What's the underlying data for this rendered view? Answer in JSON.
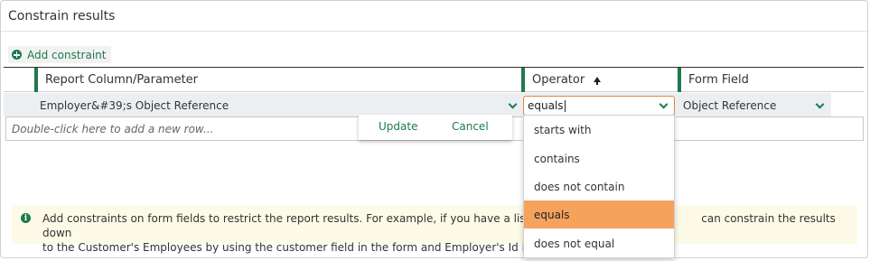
{
  "panel": {
    "title": "Constrain results"
  },
  "toolbar": {
    "add_constraint_label": "Add constraint",
    "add_icon": "plus-circle-icon"
  },
  "grid": {
    "columns": [
      {
        "label": "Report Column/Parameter"
      },
      {
        "label": "Operator",
        "sort": "ascending",
        "sort_icon": "arrow-up-icon"
      },
      {
        "label": "Form Field"
      }
    ],
    "edit_row": {
      "report_column": "Employer&#39;s Object Reference",
      "operator": "equals",
      "form_field": "Object Reference"
    },
    "new_row_placeholder": "Double-click here to add a new row..."
  },
  "row_actions": {
    "update_label": "Update",
    "cancel_label": "Cancel"
  },
  "operator_dropdown": {
    "options": [
      "starts with",
      "contains",
      "does not contain",
      "equals",
      "does not equal"
    ],
    "selected": "equals"
  },
  "info": {
    "icon": "info-icon",
    "line1_before": "Add constraints on form fields to restrict the report results. For example, if you have a list",
    "line1_after": "can constrain the results down",
    "line2": "to the Customer's Employees by using the customer field in the form and Employer's Id in"
  },
  "colors": {
    "accent": "#1c7a4e",
    "highlight": "#f5a25d",
    "focus_border": "#e8833a",
    "info_bg": "#fdfbe7"
  }
}
